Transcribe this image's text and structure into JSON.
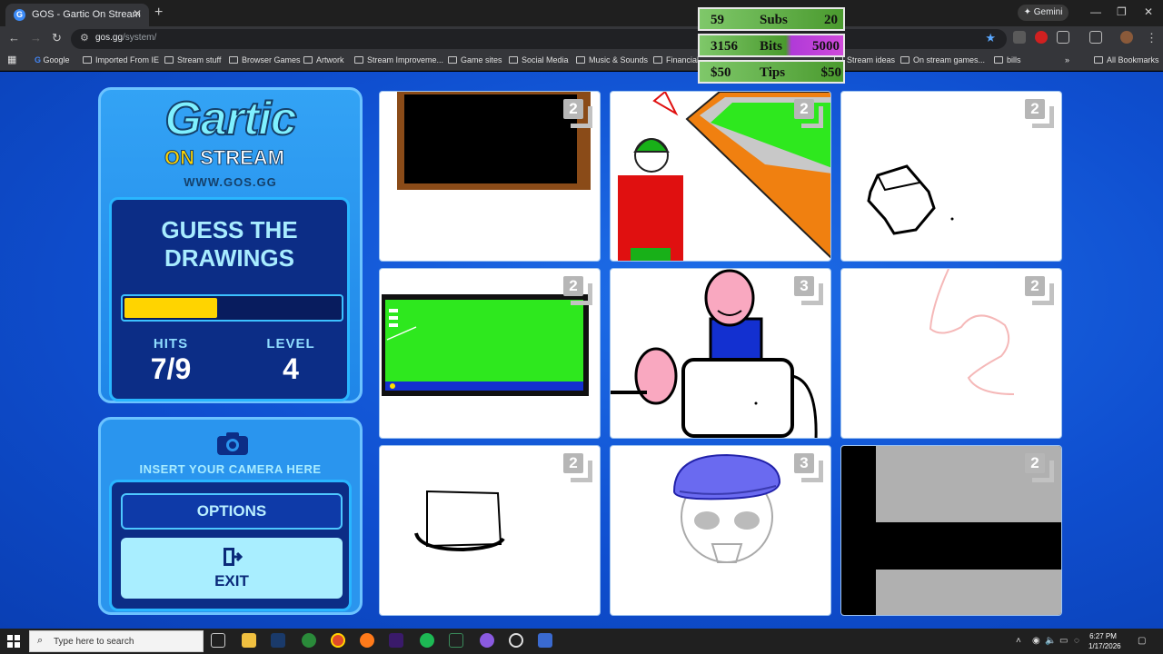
{
  "browser": {
    "tab_title": "GOS - Gartic On Stream",
    "tab_favicon": "G",
    "url_host": "gos.gg",
    "url_path": "/system/",
    "gemini_label": "Gemini",
    "bookmarks": [
      "Google",
      "Imported From IE",
      "Stream stuff",
      "Browser Games",
      "Artwork",
      "Stream Improveme...",
      "Game sites",
      "Social Media",
      "Music & Sounds",
      "Financial",
      "Stream ideas",
      "On stream games...",
      "bills",
      "All Bookmarks"
    ]
  },
  "overlay": {
    "subs": {
      "current": "59",
      "label": "Subs",
      "goal": "20"
    },
    "bits": {
      "current": "3156",
      "label": "Bits",
      "goal": "5000"
    },
    "tips": {
      "current": "$50",
      "label": "Tips",
      "goal": "$50"
    }
  },
  "game": {
    "logo_top": "Gartic",
    "logo_on": "ON",
    "logo_stream": "STREAM",
    "site": "WWW.GOS.GG",
    "mode_line1": "GUESS THE",
    "mode_line2": "DRAWINGS",
    "progress": 0.43,
    "hits_label": "HITS",
    "hits_value": "7/9",
    "level_label": "LEVEL",
    "level_value": "4",
    "camera_text": "INSERT YOUR CAMERA HERE",
    "options_label": "OPTIONS",
    "exit_label": "EXIT",
    "cards": [
      {
        "badge": "2"
      },
      {
        "badge": "2"
      },
      {
        "badge": "2"
      },
      {
        "badge": "2"
      },
      {
        "badge": "3"
      },
      {
        "badge": "2"
      },
      {
        "badge": "2"
      },
      {
        "badge": "3"
      },
      {
        "badge": "2"
      }
    ]
  },
  "taskbar": {
    "search_placeholder": "Type here to search",
    "time": "6:27 PM",
    "date": "1/17/2026"
  },
  "colors": {
    "page_bg": "#1565e0",
    "panel": "#2a95ee",
    "gold": "#ffd400",
    "overlay_green": "#5aa83a",
    "overlay_purple": "#a83ad2"
  }
}
